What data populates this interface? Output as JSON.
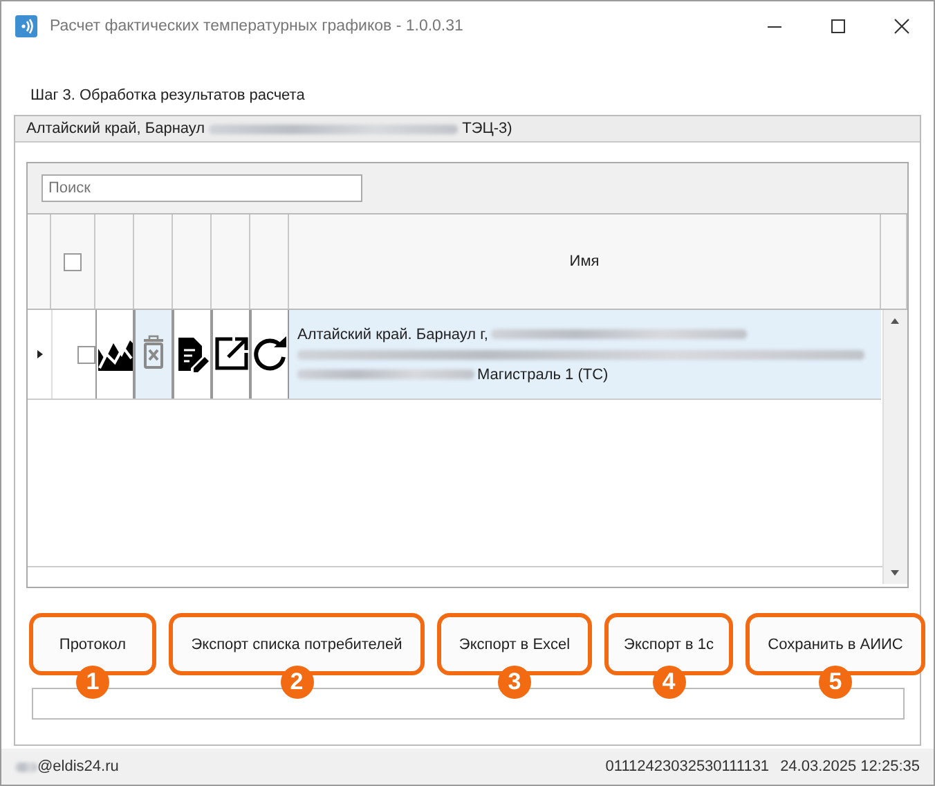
{
  "window": {
    "title": "Расчет фактических температурных графиков - 1.0.0.31"
  },
  "step": "Шаг 3. Обработка результатов расчета",
  "group": {
    "header_start": "Алтайский край, Барнаул",
    "header_end": "ТЭЦ-3)"
  },
  "search": {
    "placeholder": "Поиск"
  },
  "table": {
    "header_checked": false,
    "name_column": "Имя",
    "rows": [
      {
        "selected": true,
        "checked": false,
        "name_start": "Алтайский край. Барнаул г,",
        "name_end": "Магистраль 1 (ТС)"
      }
    ]
  },
  "buttons": [
    {
      "label": "Протокол",
      "badge": "1"
    },
    {
      "label": "Экспорт списка потребителей",
      "badge": "2"
    },
    {
      "label": "Экспорт в Excel",
      "badge": "3"
    },
    {
      "label": "Экспорт в 1с",
      "badge": "4"
    },
    {
      "label": "Сохранить в АИИС",
      "badge": "5"
    }
  ],
  "status_bar": {
    "user": "@eldis24.ru",
    "code": "01112423032530111131",
    "datetime": "24.03.2025 12:25:35"
  }
}
